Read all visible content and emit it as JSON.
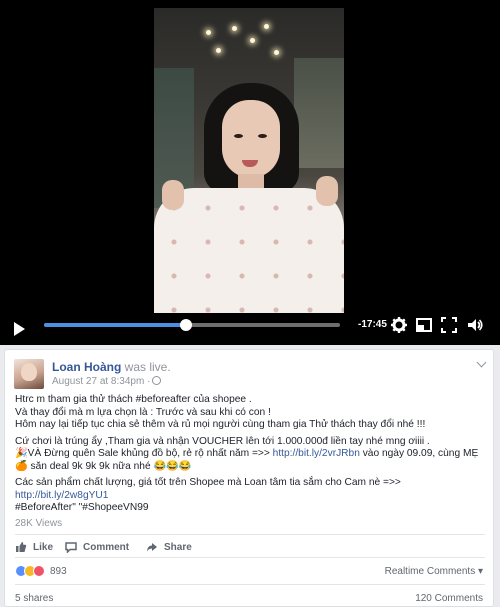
{
  "video": {
    "time_remaining": "-17:45",
    "progress": 0.48,
    "controls": [
      "play-icon",
      "gear-icon",
      "popout-icon",
      "fullscreen-icon",
      "volume-icon"
    ]
  },
  "post": {
    "author": "Loan Hoàng",
    "status": "was live.",
    "date": "August 27 at 8:34pm ·",
    "paragraphs": [
      {
        "lines": [
          "Htrc m tham gia thử thách #beforeafter của shopee .",
          "Và thay đổi mà m lựa chọn là : Trước và sau khi có con !",
          "Hôm nay lại tiếp tục chia sẻ thêm và rủ mọi người cùng tham gia Thử thách thay đổi nhé !!!"
        ]
      },
      {
        "lines": [
          "Cứ chơi là trúng ẩy ,Tham gia và nhận VOUCHER lên tới 1.000.000đ liền tay nhé mng ơiiii ."
        ]
      }
    ],
    "promo_line1_pre": "🎉VÀ Đừng quên Sale khủng đồ bộ, rẻ rộ nhất năm =>> ",
    "promo_link1": "http://bit.ly/2vrJRbn",
    "promo_line1_post": " vào ngày 09.09, cùng MẸ",
    "promo_line2": "🍊 săn deal 9k 9k 9k nữa nhé 😂😂😂",
    "products_pre": "Các sản phẩm chất lượng, giá tốt trên Shopee mà Loan tâm tia sắm cho Cam nè =>> ",
    "products_link": "http://bit.ly/2w8gYU1",
    "hashtags": "#BeforeAfter\" \"#ShopeeVN99",
    "views": "28K Views",
    "actions": {
      "like": "Like",
      "comment": "Comment",
      "share": "Share"
    },
    "reaction_count": "893",
    "realtime": "Realtime Comments ▾",
    "shares": "5 shares",
    "comments": "120 Comments"
  },
  "colors": {
    "link": "#365899",
    "progress": "#4a90e2",
    "background": "#e9ebee"
  }
}
